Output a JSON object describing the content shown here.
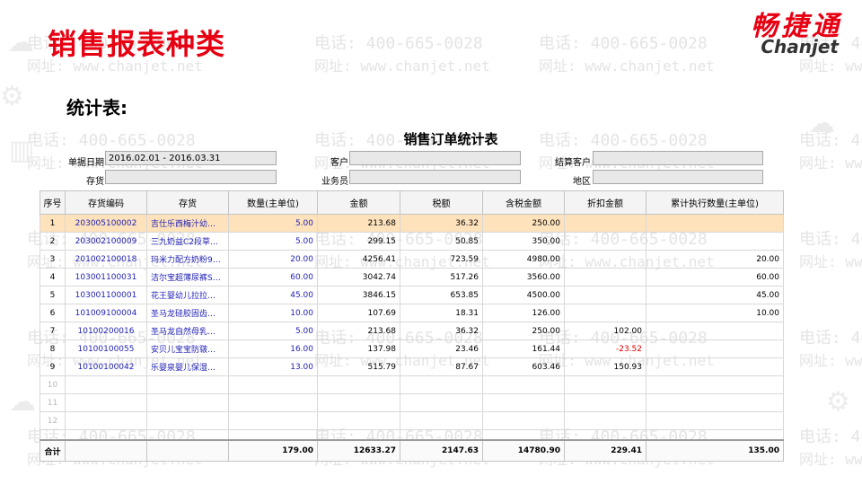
{
  "header": {
    "slide_title": "销售报表种类",
    "subtitle": "统计表:"
  },
  "logo": {
    "cn": "畅捷通",
    "en": "Chanjet"
  },
  "watermark": {
    "phone": "电话: 400-665-0028",
    "web": "网址: www.chanjet.net"
  },
  "report": {
    "title": "销售订单统计表",
    "filters": {
      "date_label": "单据日期",
      "date_value": "2016.02.01 - 2016.03.31",
      "customer_label": "客户",
      "customer_value": "",
      "settle_label": "结算客户",
      "settle_value": "",
      "stock_label": "存货",
      "stock_value": "",
      "sales_label": "业务员",
      "sales_value": "",
      "region_label": "地区",
      "region_value": ""
    },
    "columns": [
      "序号",
      "存货编码",
      "存货",
      "数量(主单位)",
      "金额",
      "税额",
      "含税金额",
      "折扣金额",
      "累计执行数量(主单位)"
    ],
    "rows": [
      [
        "1",
        "203005100002",
        "吉仕乐西梅汁幼…",
        "5.00",
        "213.68",
        "36.32",
        "250.00",
        "",
        ""
      ],
      [
        "2",
        "203002100009",
        "三九奶益C2段草…",
        "5.00",
        "299.15",
        "50.85",
        "350.00",
        "",
        ""
      ],
      [
        "3",
        "201002100018",
        "玛米力配方奶粉9…",
        "20.00",
        "4256.41",
        "723.59",
        "4980.00",
        "",
        "20.00"
      ],
      [
        "4",
        "103001100031",
        "洁尔宝超薄尿裤S…",
        "60.00",
        "3042.74",
        "517.26",
        "3560.00",
        "",
        "60.00"
      ],
      [
        "5",
        "103001100001",
        "花王婴幼儿拉拉…",
        "45.00",
        "3846.15",
        "653.85",
        "4500.00",
        "",
        "45.00"
      ],
      [
        "6",
        "101009100004",
        "圣马龙硅胶固齿…",
        "10.00",
        "107.69",
        "18.31",
        "126.00",
        "",
        "10.00"
      ],
      [
        "7",
        "10100200016",
        "圣马龙自然母乳…",
        "5.00",
        "213.68",
        "36.32",
        "250.00",
        "102.00",
        ""
      ],
      [
        "8",
        "10100100055",
        "安贝儿宝宝防皲…",
        "16.00",
        "137.98",
        "23.46",
        "161.44",
        "-23.52",
        ""
      ],
      [
        "9",
        "10100100042",
        "乐婴泉婴儿保湿…",
        "13.00",
        "515.79",
        "87.67",
        "603.46",
        "150.93",
        ""
      ]
    ],
    "empty_rows": [
      "10",
      "11",
      "12",
      ""
    ],
    "totals": {
      "label": "合计",
      "qty": "179.00",
      "amount": "12633.27",
      "tax": "2147.63",
      "amount_tax": "14780.90",
      "discount": "229.41",
      "executed": "135.00"
    }
  }
}
